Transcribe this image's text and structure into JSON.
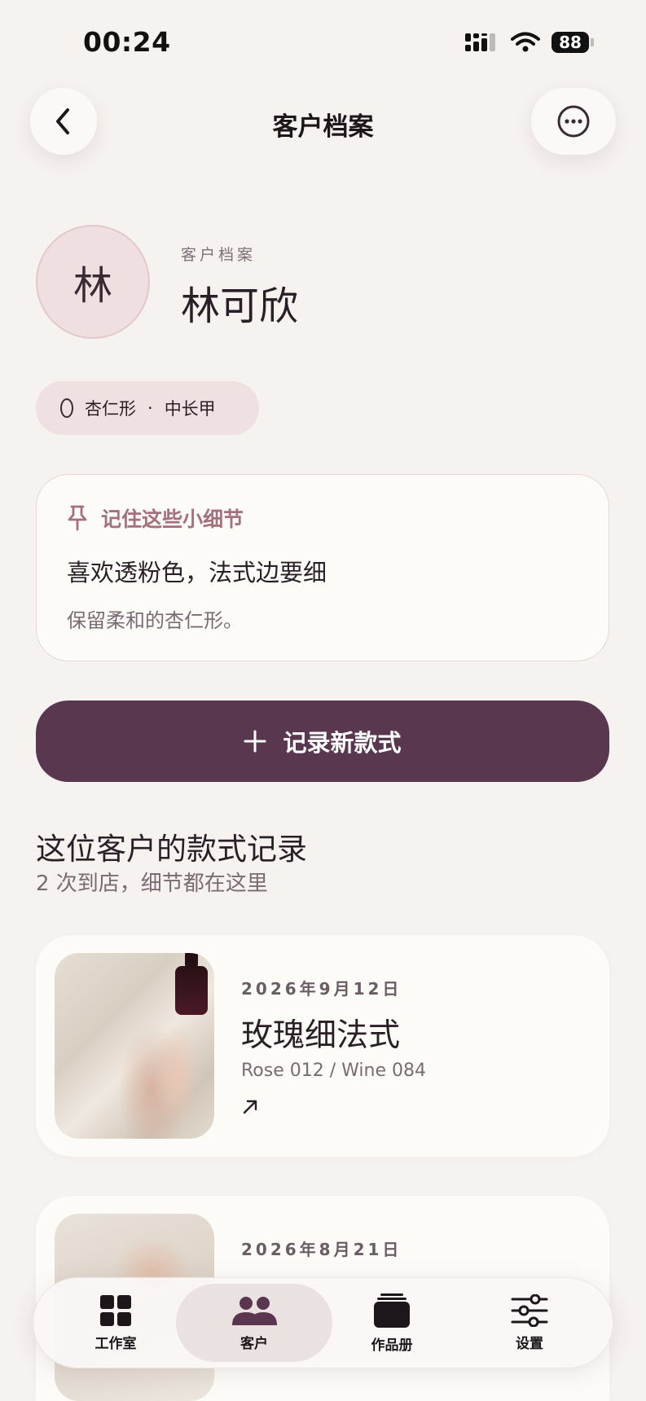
{
  "status_bar": {
    "time": "00:24",
    "battery": "88"
  },
  "nav": {
    "title": "客户档案"
  },
  "profile": {
    "avatar_initial": "林",
    "kicker": "客户档案",
    "name": "林可欣"
  },
  "chip": {
    "shape": "杏仁形",
    "separator": "·",
    "length": "中长甲"
  },
  "note": {
    "heading": "记住这些小细节",
    "main": "喜欢透粉色，法式边要细",
    "sub": "保留柔和的杏仁形。"
  },
  "primary_button": {
    "label": "记录新款式"
  },
  "records_section": {
    "title": "这位客户的款式记录",
    "subtitle": "2 次到店，细节都在这里",
    "items": [
      {
        "date": "2026年9月12日",
        "title": "玫瑰细法式",
        "colors": "Rose 012 / Wine 084"
      },
      {
        "date": "2026年8月21日"
      }
    ]
  },
  "tabbar": {
    "items": [
      {
        "label": "工作室",
        "icon": "grid-icon"
      },
      {
        "label": "客户",
        "icon": "people-icon",
        "active": true
      },
      {
        "label": "作品册",
        "icon": "stack-icon"
      },
      {
        "label": "设置",
        "icon": "sliders-icon"
      }
    ]
  },
  "colors": {
    "background": "#f6f2f0",
    "accent": "#59374f",
    "note_heading": "#a56f7c",
    "chip_bg": "#efe0e1"
  }
}
